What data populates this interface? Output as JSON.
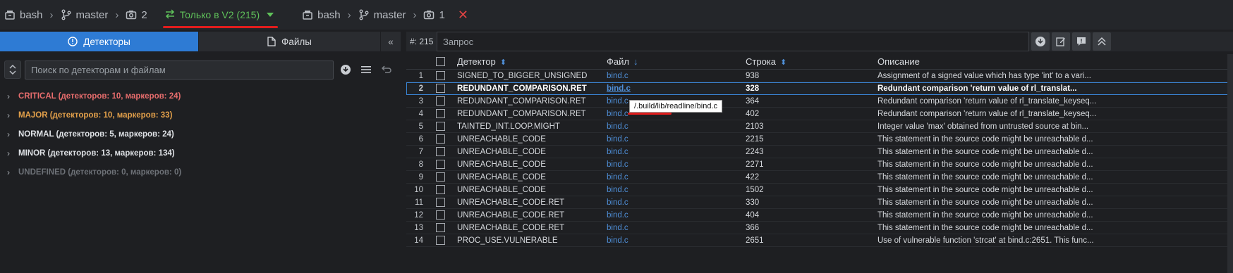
{
  "topbar": {
    "left": {
      "repo": "bash",
      "branch": "master",
      "snapshot": "2"
    },
    "compare_label": "Только в V2 (215)",
    "right": {
      "repo": "bash",
      "branch": "master",
      "snapshot": "1"
    },
    "close_symbol": "✕",
    "colors": {
      "compare": "#5fc15a",
      "underline": "#e21d1d",
      "close": "#e04343"
    }
  },
  "left_panel": {
    "tabs": {
      "detectors": "Детекторы",
      "files": "Файлы",
      "collapse_icon": "«"
    },
    "search_placeholder": "Поиск по детекторам и файлам",
    "tree": [
      {
        "label": "CRITICAL (детекторов: 10, маркеров: 24)",
        "severity": "critical",
        "color": "#e86d6d"
      },
      {
        "label": "MAJOR (детекторов: 10, маркеров: 33)",
        "severity": "major",
        "color": "#e3a04a"
      },
      {
        "label": "NORMAL (детекторов: 5, маркеров: 24)",
        "severity": "normal",
        "color": "#dfe2e6"
      },
      {
        "label": "MINOR (детекторов: 13, маркеров: 134)",
        "severity": "minor",
        "color": "#dfe2e6"
      },
      {
        "label": "UNDEFINED (детекторов: 0, маркеров: 0)",
        "severity": "undefined",
        "color": "#6d7177"
      }
    ]
  },
  "right_panel": {
    "count": "#: 215",
    "query_placeholder": "Запрос",
    "headers": {
      "detector": "Детектор",
      "file": "Файл",
      "line": "Строка",
      "description": "Описание"
    },
    "rows": [
      {
        "n": "1",
        "detector": "SIGNED_TO_BIGGER_UNSIGNED",
        "file": "bind.c",
        "line": "938",
        "desc": "Assignment of a signed value which has type 'int' to a vari..."
      },
      {
        "n": "2",
        "detector": "REDUNDANT_COMPARISON.RET",
        "file": "bind.c",
        "line": "328",
        "desc": "Redundant comparison 'return value of rl_translat...",
        "selected": true
      },
      {
        "n": "3",
        "detector": "REDUNDANT_COMPARISON.RET",
        "file": "bind.c",
        "line": "364",
        "desc": "Redundant comparison 'return value of rl_translate_keyseq..."
      },
      {
        "n": "4",
        "detector": "REDUNDANT_COMPARISON.RET",
        "file": "bind.c",
        "line": "402",
        "desc": "Redundant comparison 'return value of rl_translate_keyseq..."
      },
      {
        "n": "5",
        "detector": "TAINTED_INT.LOOP.MIGHT",
        "file": "bind.c",
        "line": "2103",
        "desc": "Integer value 'max' obtained from untrusted source at bin..."
      },
      {
        "n": "6",
        "detector": "UNREACHABLE_CODE",
        "file": "bind.c",
        "line": "2215",
        "desc": "This statement in the source code might be unreachable d..."
      },
      {
        "n": "7",
        "detector": "UNREACHABLE_CODE",
        "file": "bind.c",
        "line": "2243",
        "desc": "This statement in the source code might be unreachable d..."
      },
      {
        "n": "8",
        "detector": "UNREACHABLE_CODE",
        "file": "bind.c",
        "line": "2271",
        "desc": "This statement in the source code might be unreachable d..."
      },
      {
        "n": "9",
        "detector": "UNREACHABLE_CODE",
        "file": "bind.c",
        "line": "422",
        "desc": "This statement in the source code might be unreachable d..."
      },
      {
        "n": "10",
        "detector": "UNREACHABLE_CODE",
        "file": "bind.c",
        "line": "1502",
        "desc": "This statement in the source code might be unreachable d..."
      },
      {
        "n": "11",
        "detector": "UNREACHABLE_CODE.RET",
        "file": "bind.c",
        "line": "330",
        "desc": "This statement in the source code might be unreachable d..."
      },
      {
        "n": "12",
        "detector": "UNREACHABLE_CODE.RET",
        "file": "bind.c",
        "line": "404",
        "desc": "This statement in the source code might be unreachable d..."
      },
      {
        "n": "13",
        "detector": "UNREACHABLE_CODE.RET",
        "file": "bind.c",
        "line": "366",
        "desc": "This statement in the source code might be unreachable d..."
      },
      {
        "n": "14",
        "detector": "PROC_USE.VULNERABLE",
        "file": "bind.c",
        "line": "2651",
        "desc": "Use of vulnerable function 'strcat' at bind.c:2651. This func..."
      }
    ],
    "tooltip": "/.build/lib/readline/bind.c"
  }
}
